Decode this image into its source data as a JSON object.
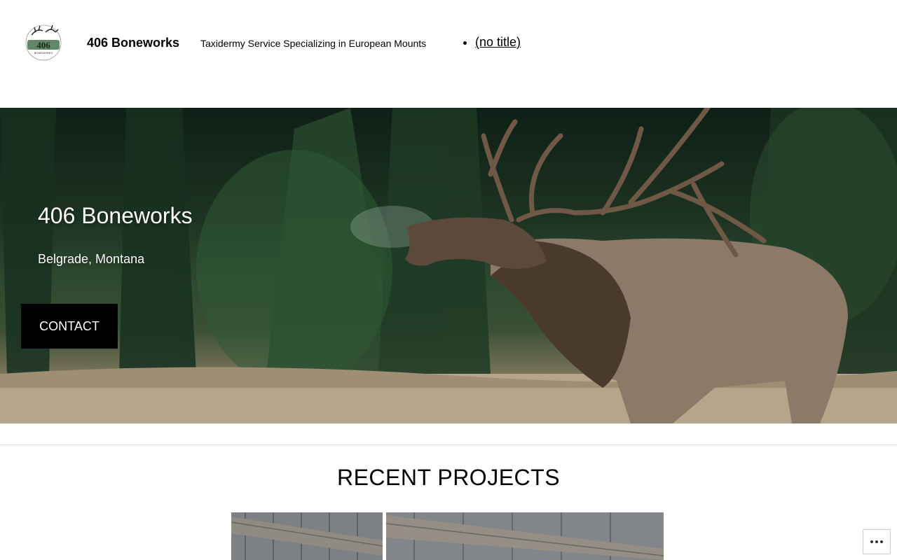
{
  "header": {
    "site_title": "406 Boneworks",
    "tagline": "Taxidermy Service Specializing in European Mounts",
    "nav_items": [
      "(no title)"
    ],
    "logo_text": "406",
    "logo_subtext": "BONEWORKS"
  },
  "hero": {
    "title": "406 Boneworks",
    "subtitle": "Belgrade, Montana",
    "button_label": "CONTACT"
  },
  "projects": {
    "heading": "RECENT PROJECTS"
  },
  "icons": {
    "more": "ellipsis-icon"
  },
  "colors": {
    "button_bg": "#000000",
    "logo_green": "#4f7a55"
  }
}
